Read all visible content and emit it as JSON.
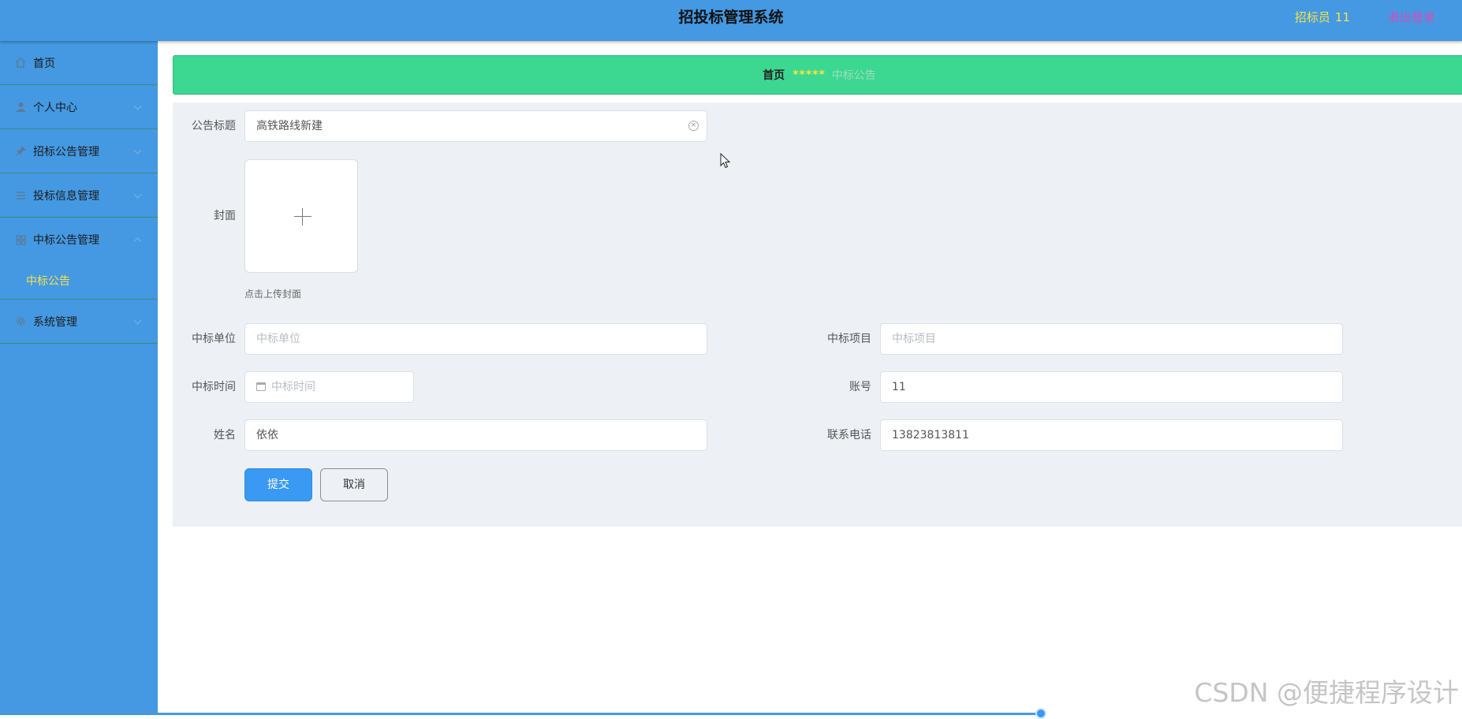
{
  "header": {
    "title": "招投标管理系统",
    "user_role": "招标员",
    "user_name": "11",
    "logout_label": "退出登录"
  },
  "sidebar": {
    "items": [
      {
        "label": "首页",
        "icon": "home-icon"
      },
      {
        "label": "个人中心",
        "icon": "user-icon"
      },
      {
        "label": "招标公告管理",
        "icon": "pin-icon"
      },
      {
        "label": "投标信息管理",
        "icon": "list-icon"
      },
      {
        "label": "中标公告管理",
        "icon": "grid-icon",
        "expanded": true,
        "children": [
          {
            "label": "中标公告"
          }
        ]
      },
      {
        "label": "系统管理",
        "icon": "settings-icon"
      }
    ]
  },
  "breadcrumb": {
    "home": "首页",
    "separator": "*****",
    "current": "中标公告"
  },
  "form": {
    "title_label": "公告标题",
    "title_value": "高铁路线新建",
    "cover_label": "封面",
    "upload_hint": "点击上传封面",
    "unit_label": "中标单位",
    "unit_placeholder": "中标单位",
    "project_label": "中标项目",
    "project_placeholder": "中标项目",
    "time_label": "中标时间",
    "time_placeholder": "中标时间",
    "account_label": "账号",
    "account_value": "11",
    "name_label": "姓名",
    "name_value": "依依",
    "phone_label": "联系电话",
    "phone_value": "13823813811",
    "submit_label": "提交",
    "cancel_label": "取消"
  },
  "watermark": "CSDN @便捷程序设计",
  "colors": {
    "primary": "#4499e2",
    "breadcrumb_bg": "#3cd791",
    "highlight": "#f6e445",
    "logout": "#d94bb8"
  }
}
